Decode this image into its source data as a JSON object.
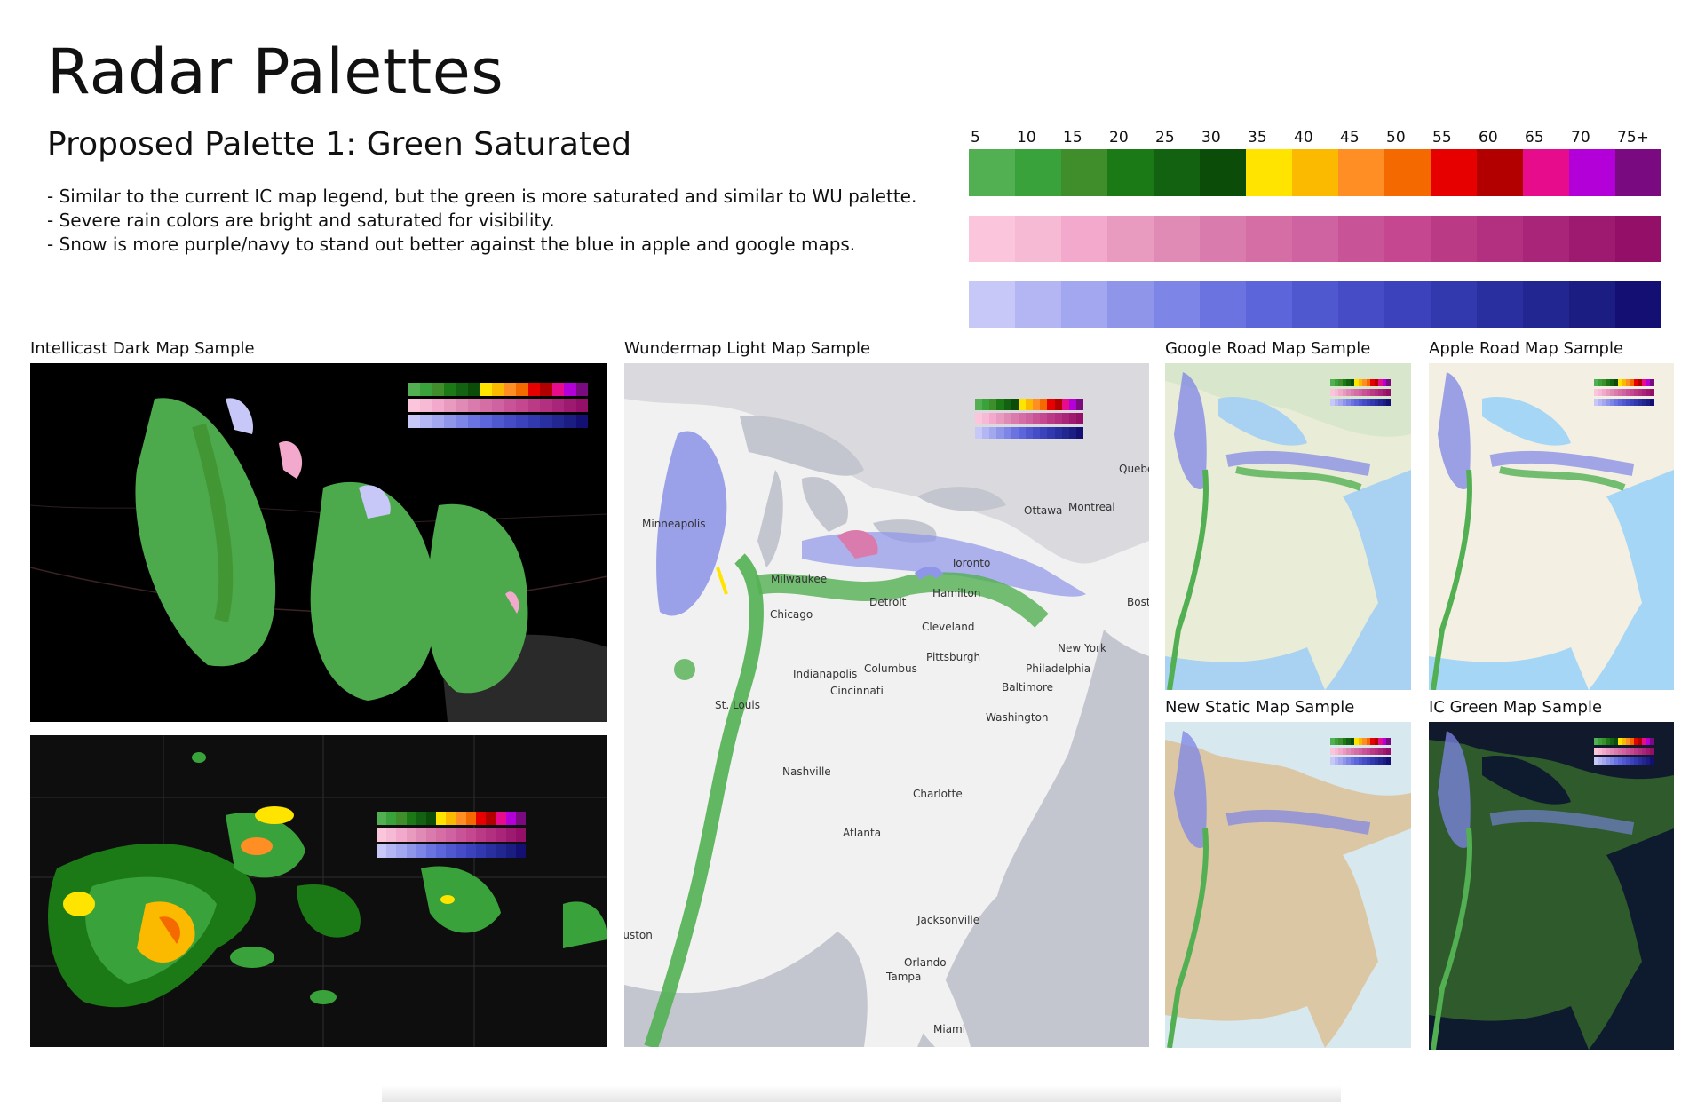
{
  "page": {
    "title": "Radar Palettes",
    "subtitle": "Proposed Palette 1: Green Saturated",
    "notes": [
      "- Similar to the current IC map legend, but the green is more saturated and similar to WU palette.",
      "- Severe rain colors are bright and saturated for visibility.",
      "- Snow is more purple/navy to stand out better against the blue in apple and google maps."
    ]
  },
  "legend": {
    "labels": [
      "5",
      "10",
      "15",
      "20",
      "25",
      "30",
      "35",
      "40",
      "45",
      "50",
      "55",
      "60",
      "65",
      "70",
      "75+"
    ],
    "rain_colors": [
      "#52b052",
      "#3aa23a",
      "#3f8e2b",
      "#1c7a16",
      "#136211",
      "#0b4d08",
      "#ffe400",
      "#fbb900",
      "#ff8f24",
      "#f46a00",
      "#e60000",
      "#b20000",
      "#e60c8c",
      "#b300d9",
      "#7a0a80"
    ],
    "mix_colors": [
      "#fbc6dc",
      "#f6bad4",
      "#f2a9cb",
      "#e89abf",
      "#e08bb6",
      "#d97bad",
      "#d66ea6",
      "#cf62a0",
      "#c95397",
      "#c4478f",
      "#bb3a86",
      "#b32f7f",
      "#a8257a",
      "#9e1a71",
      "#941068"
    ],
    "snow_colors": [
      "#c7c8f8",
      "#b3b6f2",
      "#a2a7ef",
      "#8f96ea",
      "#7d85e6",
      "#6a73e0",
      "#5c65d9",
      "#5058d0",
      "#454cc6",
      "#3b42bb",
      "#3239ae",
      "#2a2f9f",
      "#222690",
      "#1b1d82",
      "#140f72"
    ]
  },
  "maps": {
    "intellicast_dark": {
      "caption": "Intellicast Dark Map Sample"
    },
    "wundermap_light": {
      "caption": "Wundermap Light Map Sample",
      "cities": [
        "Minneapolis",
        "Milwaukee",
        "Chicago",
        "Detroit",
        "Cleveland",
        "Toronto",
        "Hamilton",
        "Ottawa",
        "Montreal",
        "Quebec",
        "Boston",
        "New York",
        "Philadelphia",
        "Pittsburgh",
        "Columbus",
        "Indianapolis",
        "Cincinnati",
        "St. Louis",
        "Baltimore",
        "Washington",
        "Nashville",
        "Charlotte",
        "Atlanta",
        "Jacksonville",
        "Orlando",
        "Tampa",
        "Miami",
        "Houston"
      ]
    },
    "google_road": {
      "caption": "Google Road Map Sample"
    },
    "apple_road": {
      "caption": "Apple Road Map Sample"
    },
    "new_static": {
      "caption": "New Static Map Sample"
    },
    "ic_green": {
      "caption": "IC Green Map Sample"
    }
  }
}
